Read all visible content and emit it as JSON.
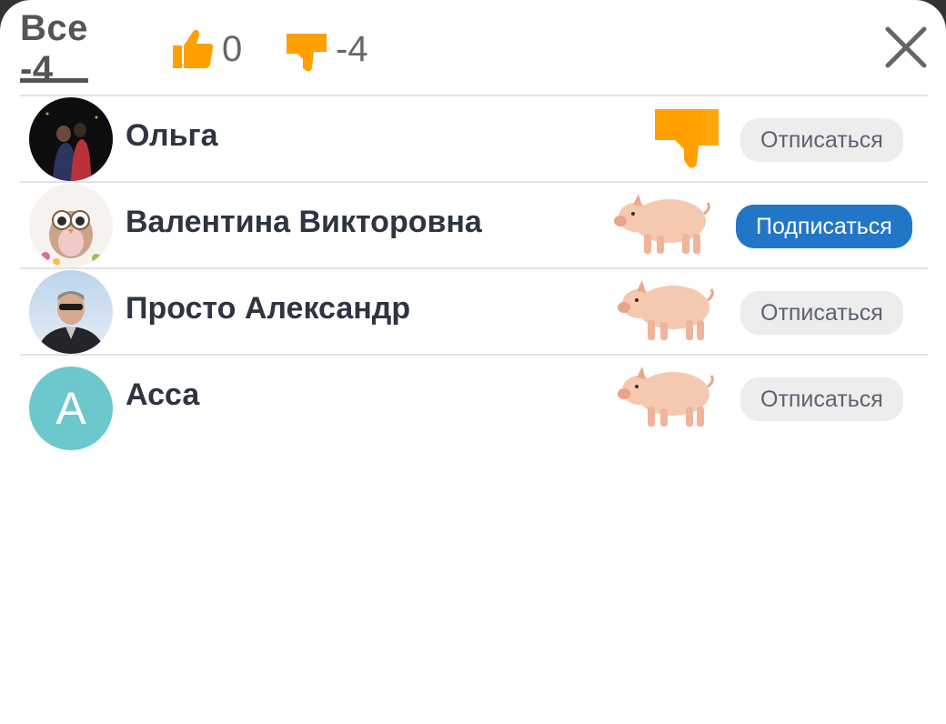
{
  "tabs": {
    "all_label": "Все -4",
    "likes_count": "0",
    "dislikes_count": "-4"
  },
  "users": [
    {
      "name": "Ольга",
      "reaction": "thumb-down-icon",
      "button": "Отписаться"
    },
    {
      "name": "Валентина Викторовна",
      "reaction": "pig-icon",
      "button": "Подписаться"
    },
    {
      "name": "Просто Александр",
      "reaction": "pig-icon",
      "button": "Отписаться"
    },
    {
      "name": "Асса",
      "avatar_letter": "А",
      "reaction": "pig-icon",
      "button": "Отписаться"
    }
  ],
  "colors": {
    "accent": "#ff9f00",
    "subscribe": "#2176c8",
    "avatar_letter_bg": "#6cc8cc"
  }
}
